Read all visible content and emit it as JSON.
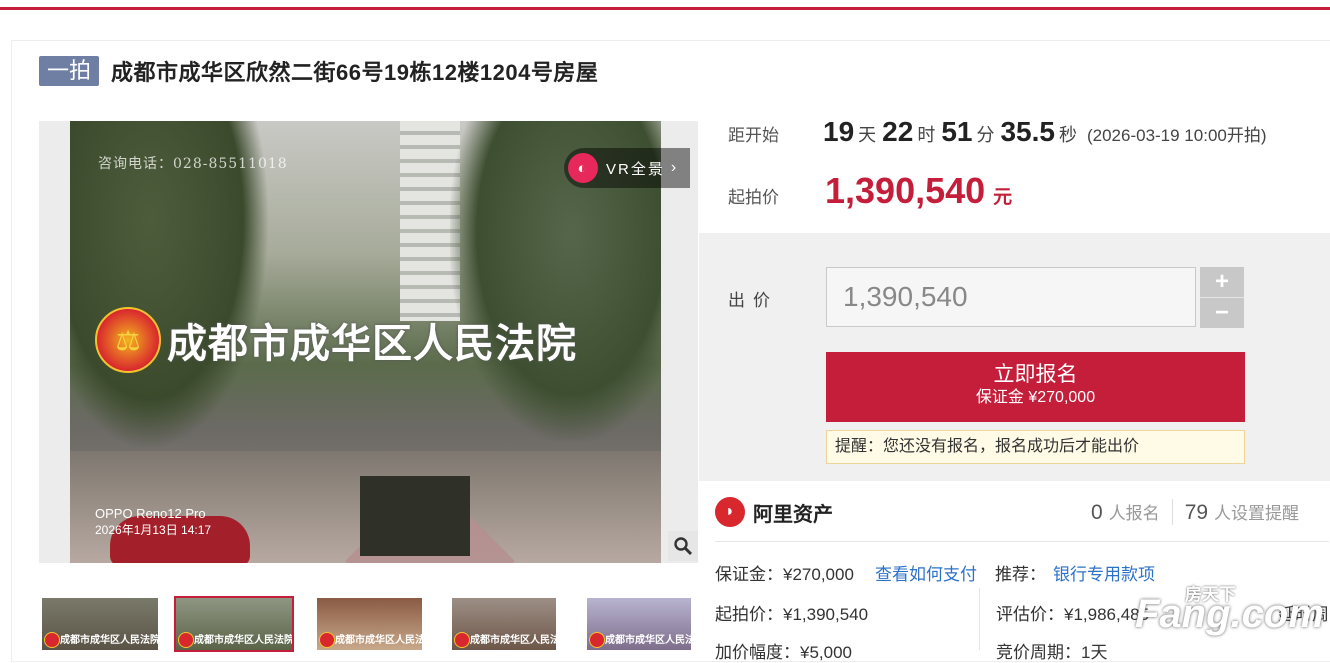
{
  "header": {
    "tag": "一拍",
    "title": "成都市成华区欣然二街66号19栋12楼1204号房屋"
  },
  "gallery": {
    "watermark_phone": "咨询电话：028-85511018",
    "watermark_court": "成都市成华区人民法院",
    "camera_model": "OPPO Reno12 Pro",
    "camera_date": "2026年1月13日 14:17",
    "vr_label": "VR全景",
    "vr_icon": "vr-logo-icon",
    "zoom_icon": "magnifier-icon",
    "thumb_label": "成都市成华区人民法院",
    "thumbs_count": 5,
    "selected_thumb": 2
  },
  "countdown": {
    "label": "距开始",
    "days": "19",
    "days_unit": "天",
    "hours": "22",
    "hours_unit": "时",
    "minutes": "51",
    "minutes_unit": "分",
    "seconds": "35.5",
    "seconds_unit": "秒",
    "start_text": "(2026-03-19 10:00开拍)"
  },
  "start_price": {
    "label": "起拍价",
    "value": "1,390,540",
    "unit": "元"
  },
  "bid": {
    "label": "出价",
    "input_value": "1,390,540",
    "plus": "+",
    "minus": "−",
    "signup_label": "立即报名",
    "deposit_label": "保证金 ¥270,000",
    "reminder": "提醒：您还没有报名，报名成功后才能出价"
  },
  "info": {
    "brand": "阿里资产",
    "signups": "0",
    "signups_label": "人报名",
    "reminders": "79",
    "reminders_label": "人设置提醒",
    "deposit": "保证金：¥270,000",
    "pay_link": "查看如何支付",
    "recommend_label": "推荐：",
    "recommend_link": "银行专用款项",
    "start_price": "起拍价：¥1,390,540",
    "eval_price": "评估价：¥1,986,485",
    "extra_cut": "延时周",
    "increment": "加价幅度：¥5,000",
    "cycle": "竞价周期：1天"
  },
  "watermark": {
    "line1": "房天下",
    "line2": "Fang.com"
  },
  "colors": {
    "accent": "#c41e3a",
    "tag_bg": "#6e7fa3",
    "link": "#2c72c7"
  }
}
